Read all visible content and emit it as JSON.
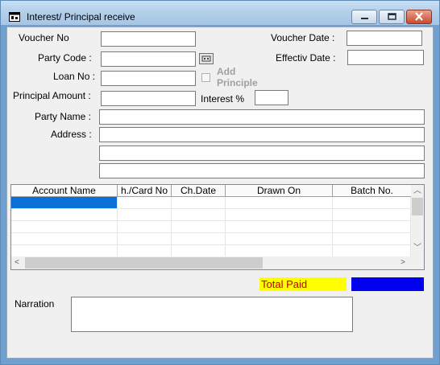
{
  "window": {
    "title": "Interest/ Principal receive"
  },
  "form": {
    "voucher_no_label": "Voucher No",
    "voucher_no_value": "",
    "party_code_label": "Party Code :",
    "party_code_value": "",
    "loan_no_label": "Loan No :",
    "loan_no_value": "",
    "principal_amount_label": "Principal Amount :",
    "principal_amount_value": "",
    "voucher_date_label": "Voucher Date :",
    "voucher_date_value": "",
    "effective_date_label": "Effectiv Date :",
    "effective_date_value": "",
    "add_principle_label": "Add Principle",
    "add_principle_checked": false,
    "interest_label": "Interest %",
    "interest_value": "",
    "party_name_label": "Party Name :",
    "party_name_value": "",
    "address_label": "Address :",
    "address_lines": [
      "",
      "",
      ""
    ]
  },
  "grid": {
    "columns": [
      "Account Name",
      "h./Card No",
      "Ch.Date",
      "Drawn On",
      "Batch No."
    ],
    "rows": [
      [
        "",
        "",
        "",
        "",
        ""
      ],
      [
        "",
        "",
        "",
        "",
        ""
      ],
      [
        "",
        "",
        "",
        "",
        ""
      ],
      [
        "",
        "",
        "",
        "",
        ""
      ],
      [
        "",
        "",
        "",
        "",
        ""
      ]
    ],
    "selected_row": 0
  },
  "totals": {
    "total_paid_label": "Total Paid",
    "total_paid_value": ""
  },
  "narration": {
    "label": "Narration",
    "value": ""
  },
  "colors": {
    "total_label_bg": "#ffff00",
    "total_label_fg": "#c00000",
    "total_value_bg": "#0000ee",
    "selection": "#0a6fd6"
  }
}
